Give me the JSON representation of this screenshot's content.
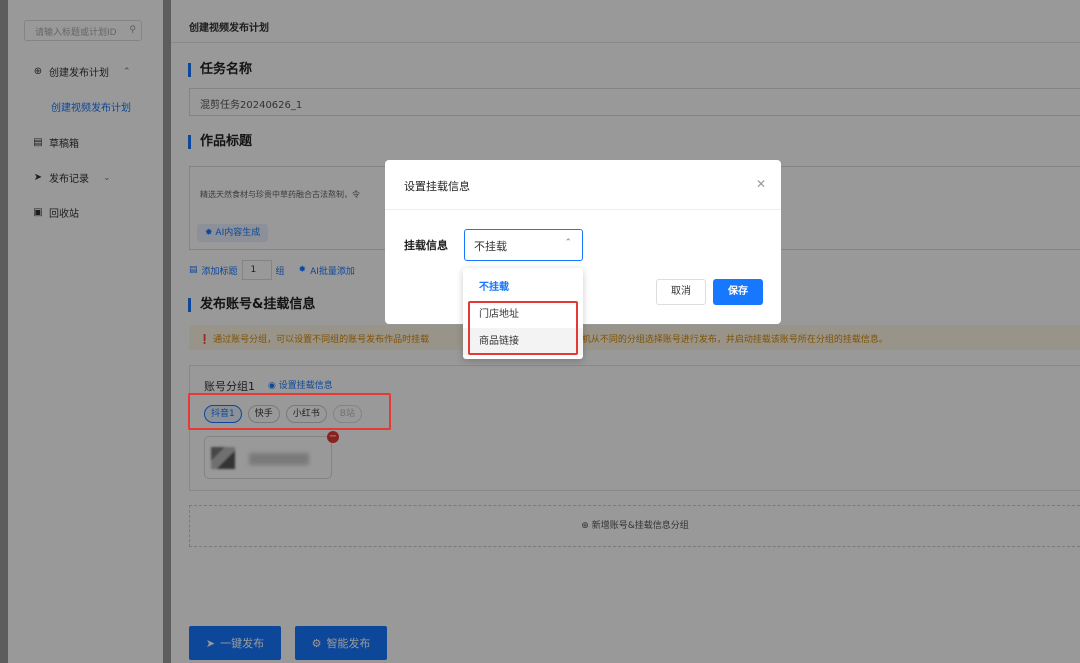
{
  "sidebar": {
    "search_placeholder": "请输入标题或计划ID",
    "items": [
      {
        "label": "创建发布计划",
        "icon": "plus-circle-icon"
      },
      {
        "label": "创建视频发布计划"
      },
      {
        "label": "草稿箱",
        "icon": "draft-box-icon"
      },
      {
        "label": "发布记录",
        "icon": "send-icon"
      },
      {
        "label": "回收站",
        "icon": "trash-icon"
      }
    ]
  },
  "main": {
    "breadcrumb": "创建视频发布计划",
    "task_name": {
      "title": "任务名称",
      "value": "混剪任务20240626_1"
    },
    "work_title": {
      "title": "作品标题",
      "content": "精选天然食材与珍贵中草药融合古法熬制，令",
      "ai_button": "AI内容生成"
    },
    "add_title": {
      "label": "添加标题",
      "count": "1",
      "unit": "组",
      "ai_batch": "AI批量添加"
    },
    "accounts": {
      "title": "发布账号&挂载信息",
      "warning_left": "通过账号分组，可以设置不同组的账号发布作品时挂载",
      "warning_right": "后将随机从不同的分组选择账号进行发布，并启动挂载该账号所在分组的挂载信息。",
      "group_name": "账号分组1",
      "set_mount_link": "设置挂载信息",
      "platforms": [
        "抖音1",
        "快手",
        "小红书",
        "B站"
      ],
      "add_group": "新增账号&挂载信息分组"
    },
    "buttons": {
      "one_click": "一键发布",
      "smart": "智能发布"
    }
  },
  "modal": {
    "title": "设置挂载信息",
    "field_label": "挂载信息",
    "select_value": "不挂载",
    "options": [
      "不挂载",
      "门店地址",
      "商品链接"
    ],
    "cancel": "取消",
    "save": "保存"
  },
  "colors": {
    "accent": "#1677ff",
    "highlight": "#e53935"
  }
}
